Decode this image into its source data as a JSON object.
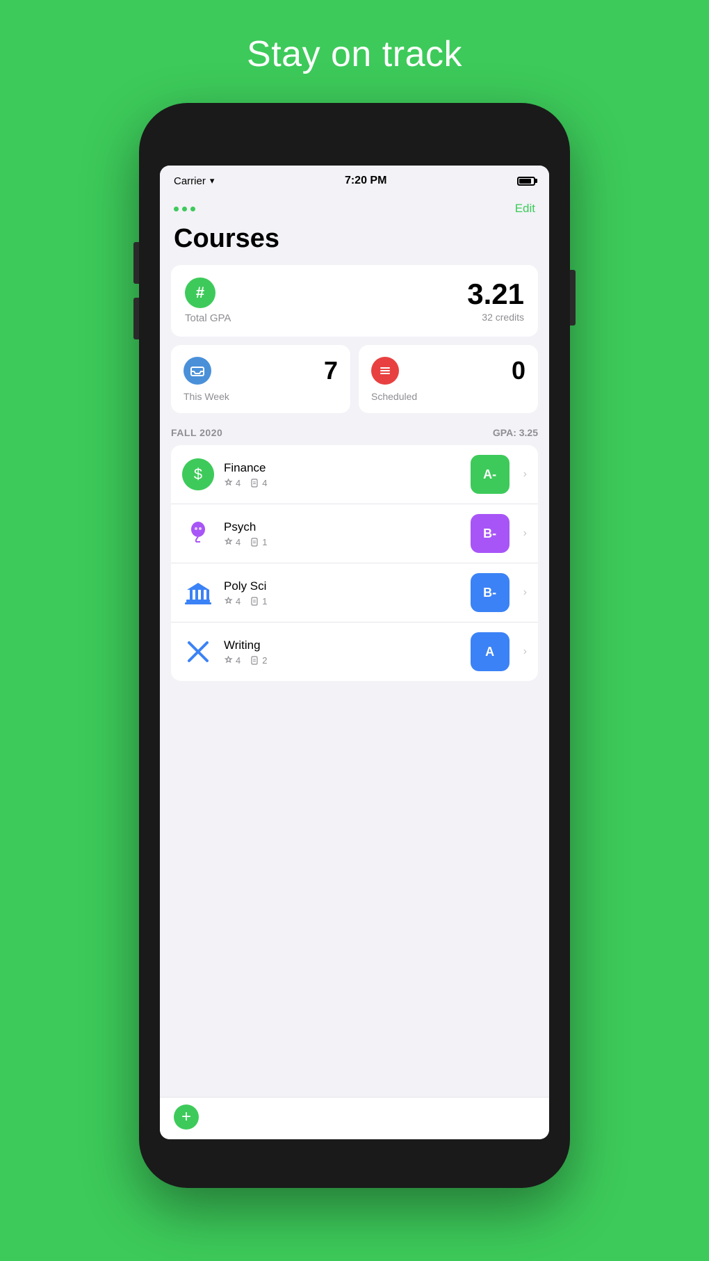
{
  "page": {
    "bg_title": "Stay on track"
  },
  "status_bar": {
    "carrier": "Carrier",
    "time": "7:20 PM"
  },
  "header": {
    "dots_label": "•••",
    "edit_label": "Edit",
    "page_title": "Courses"
  },
  "gpa_card": {
    "icon": "#",
    "label": "Total GPA",
    "value": "3.21",
    "credits": "32 credits"
  },
  "this_week_card": {
    "label": "This Week",
    "value": "7"
  },
  "scheduled_card": {
    "label": "Scheduled",
    "value": "0"
  },
  "semester": {
    "label": "FALL 2020",
    "gpa": "GPA: 3.25"
  },
  "courses": [
    {
      "name": "Finance",
      "stars": "4",
      "docs": "4",
      "grade": "A-",
      "grade_color": "grade-green",
      "icon_type": "dollar",
      "icon_class": "course-icon-green"
    },
    {
      "name": "Psych",
      "stars": "4",
      "docs": "1",
      "grade": "B-",
      "grade_color": "grade-purple",
      "icon_type": "bulb",
      "icon_class": "course-icon-purple"
    },
    {
      "name": "Poly Sci",
      "stars": "4",
      "docs": "1",
      "grade": "B-",
      "grade_color": "grade-blue",
      "icon_type": "gov",
      "icon_class": "course-icon-blue-gov"
    },
    {
      "name": "Writing",
      "stars": "4",
      "docs": "2",
      "grade": "A",
      "grade_color": "grade-blue",
      "icon_type": "pencil",
      "icon_class": "course-icon-pencil"
    }
  ],
  "add_button": {
    "label": "+"
  }
}
